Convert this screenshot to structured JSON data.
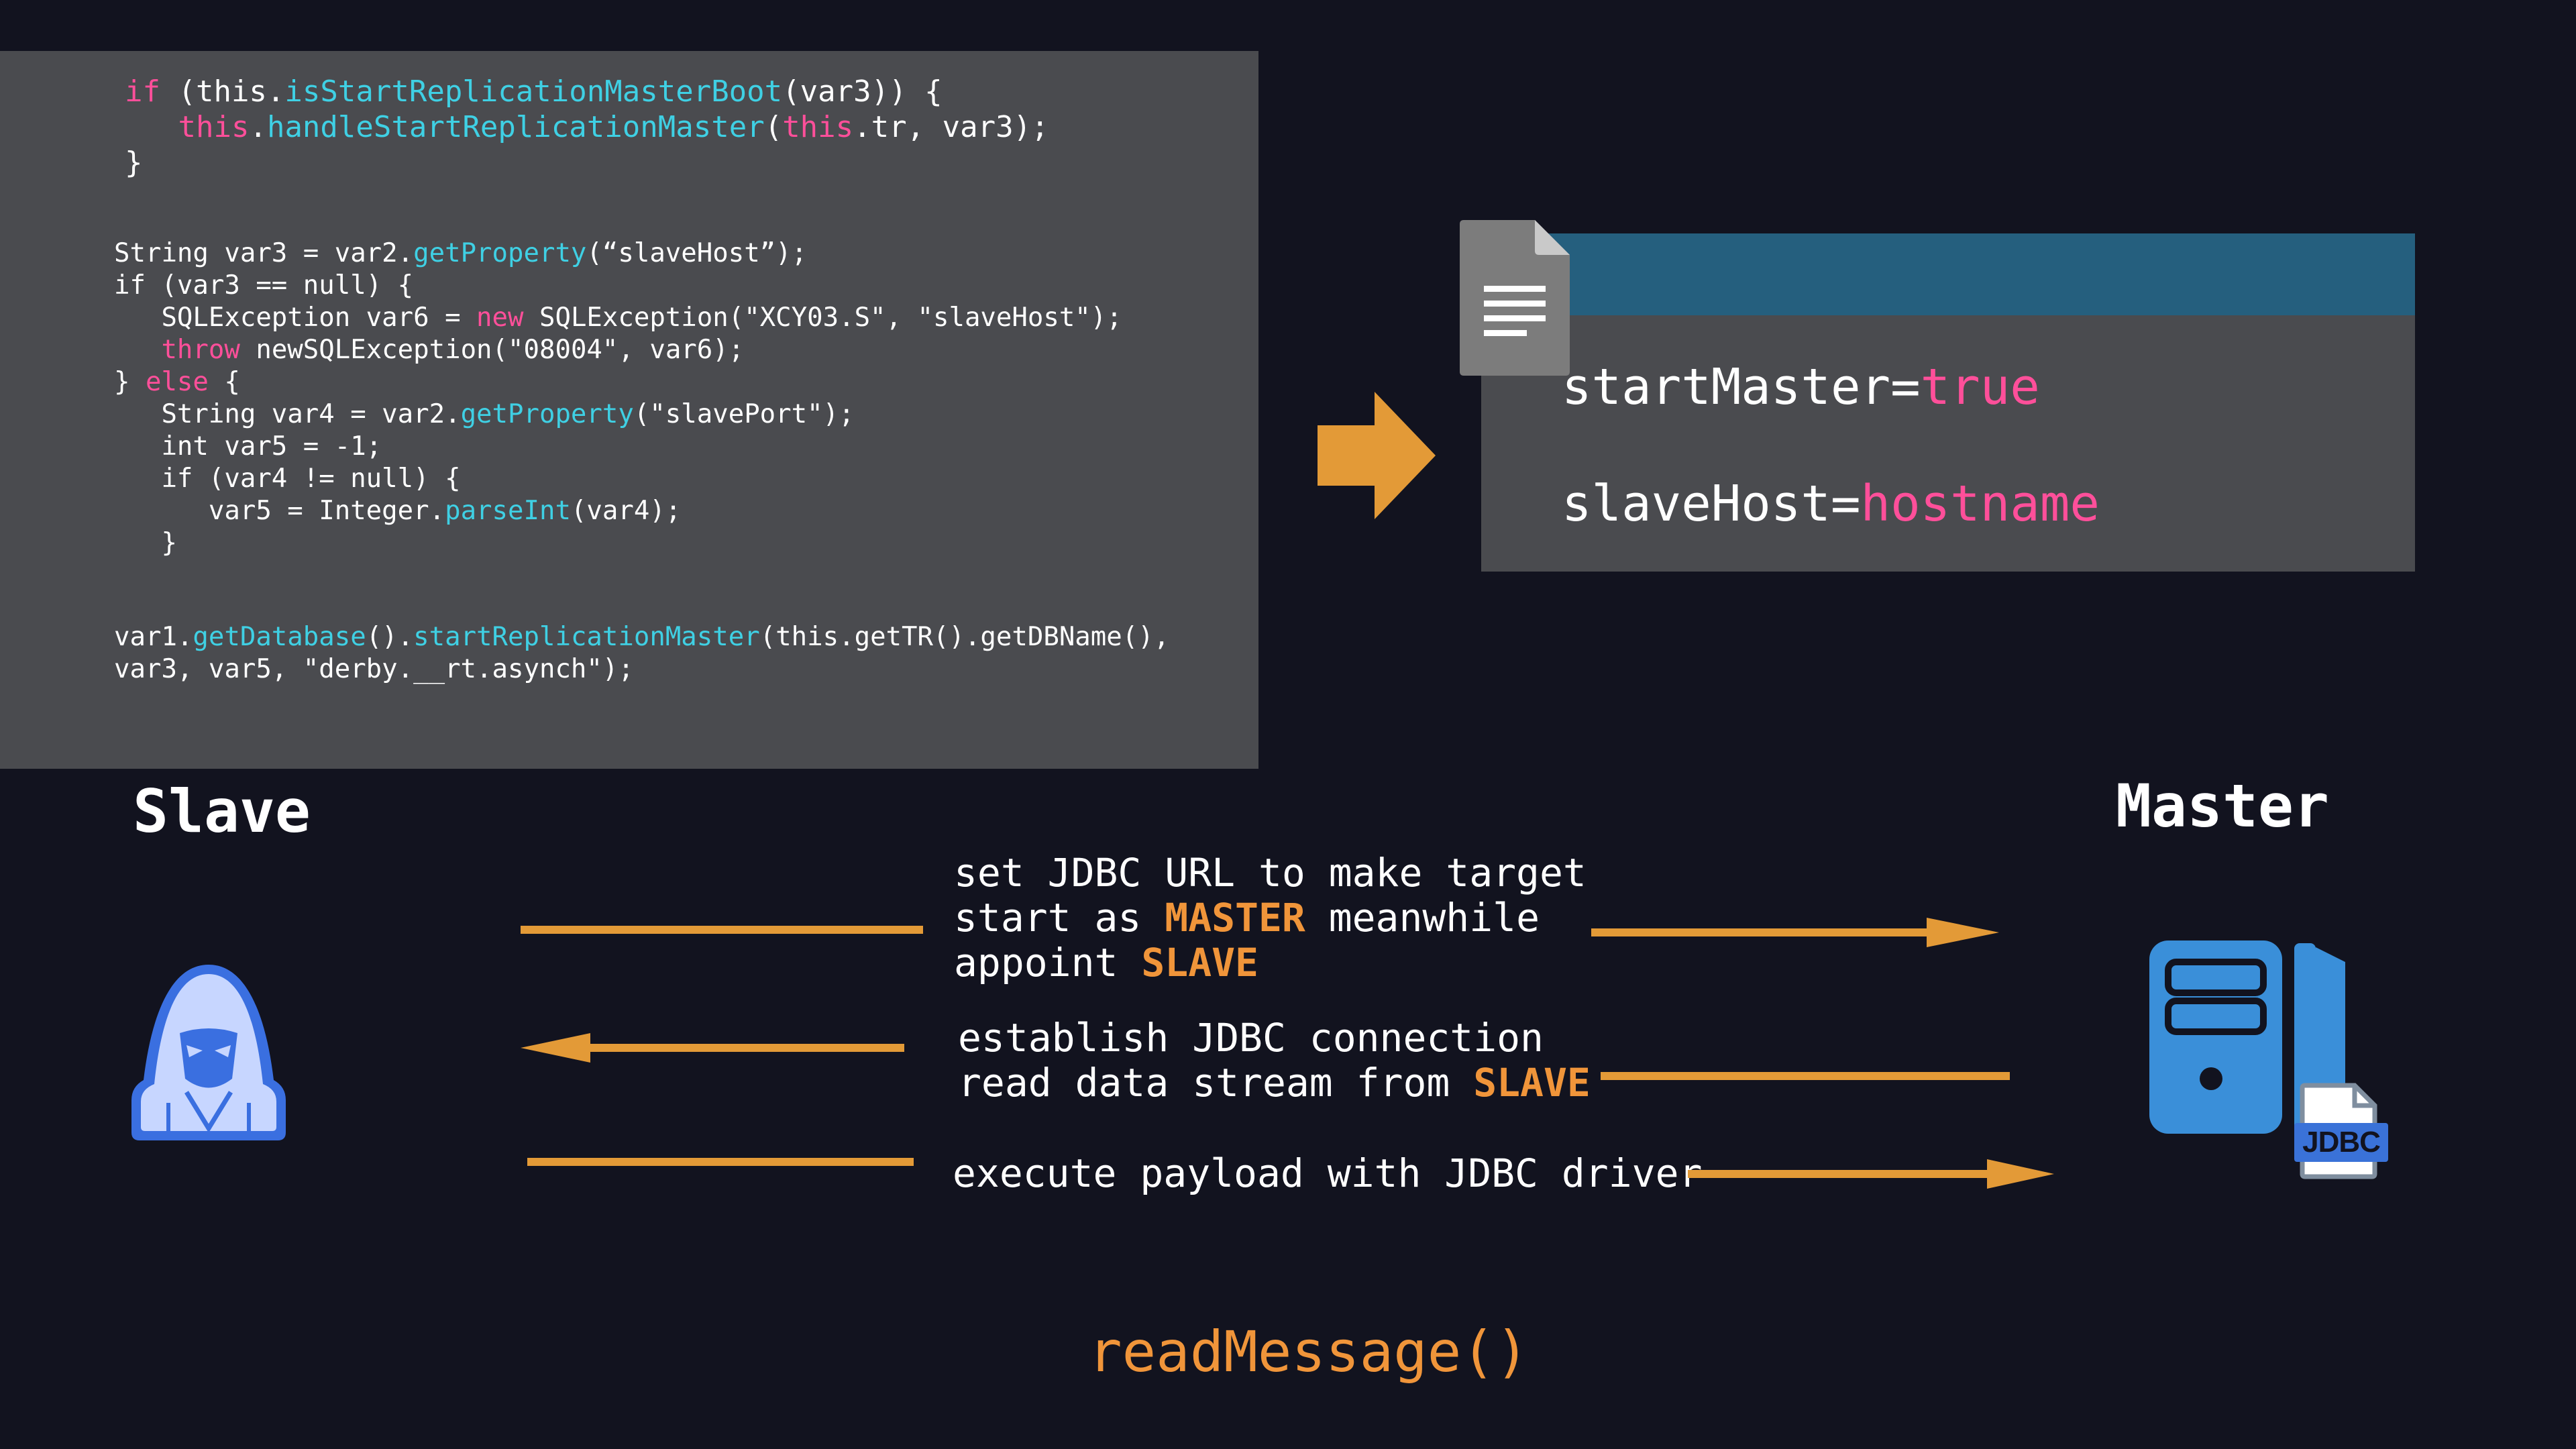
{
  "code": {
    "block1": [
      [
        {
          "t": "if",
          "c": "kw"
        },
        {
          "t": " (this."
        },
        {
          "t": "isStartReplicationMasterBoot",
          "c": "fn"
        },
        {
          "t": "(var3)) {"
        }
      ],
      [
        {
          "t": "   "
        },
        {
          "t": "this",
          "c": "kw"
        },
        {
          "t": "."
        },
        {
          "t": "handleStartReplicationMaster",
          "c": "fn"
        },
        {
          "t": "("
        },
        {
          "t": "this",
          "c": "kw"
        },
        {
          "t": ".tr, var3);"
        }
      ],
      [
        {
          "t": "}"
        }
      ]
    ],
    "block2": [
      [
        {
          "t": "String var3 = var2."
        },
        {
          "t": "getProperty",
          "c": "fn"
        },
        {
          "t": "(“slaveHost”);"
        }
      ],
      [
        {
          "t": "if (var3 == null) {"
        }
      ],
      [
        {
          "t": "   SQLException var6 = "
        },
        {
          "t": "new",
          "c": "kw"
        },
        {
          "t": " SQLException(\"XCY03.S\", \"slaveHost\");"
        }
      ],
      [
        {
          "t": "   "
        },
        {
          "t": "throw",
          "c": "kw"
        },
        {
          "t": " newSQLException(\"08004\", var6);"
        }
      ],
      [
        {
          "t": "} "
        },
        {
          "t": "else",
          "c": "kw"
        },
        {
          "t": " {"
        }
      ],
      [
        {
          "t": "   String var4 = var2."
        },
        {
          "t": "getProperty",
          "c": "fn"
        },
        {
          "t": "(\"slavePort\");"
        }
      ],
      [
        {
          "t": "   int var5 = -1;"
        }
      ],
      [
        {
          "t": "   if (var4 != null) {"
        }
      ],
      [
        {
          "t": "      var5 = Integer."
        },
        {
          "t": "parseInt",
          "c": "fn"
        },
        {
          "t": "(var4);"
        }
      ],
      [
        {
          "t": "   }"
        }
      ]
    ],
    "block3": [
      [
        {
          "t": "var1."
        },
        {
          "t": "getDatabase",
          "c": "fn"
        },
        {
          "t": "()."
        },
        {
          "t": "startReplicationMaster",
          "c": "fn"
        },
        {
          "t": "(this.getTR().getDBName(),"
        }
      ],
      [
        {
          "t": "var3, var5, \"derby.__rt.asynch\");"
        }
      ]
    ]
  },
  "config": {
    "line1_key": "startMaster=",
    "line1_value": "true",
    "line2_key": "slaveHost=",
    "line2_value": "hostname"
  },
  "labels": {
    "slave_title": "Slave",
    "master_title": "Master",
    "jdbc_badge": "JDBC",
    "read_message": "readMessage()"
  },
  "messages": [
    [
      {
        "t": "set JDBC URL to make target\nstart as "
      },
      {
        "t": "MASTER",
        "c": "hl"
      },
      {
        "t": " meanwhile\nappoint "
      },
      {
        "t": "SLAVE",
        "c": "hl"
      }
    ],
    [
      {
        "t": "establish JDBC connection\nread data stream from "
      },
      {
        "t": "SLAVE",
        "c": "hl"
      }
    ],
    [
      {
        "t": "execute payload with JDBC driver"
      }
    ]
  ],
  "colors": {
    "background": "#12131f",
    "panel": "#4a4b4f",
    "header_bar": "#255f7e",
    "keyword": "#ff4f9a",
    "function": "#3fd0e4",
    "accent_orange": "#f0953a",
    "server_blue": "#3a8fd9"
  },
  "icons": [
    "document-icon",
    "right-arrow-icon",
    "hacker-icon",
    "server-icon",
    "jdbc-file-icon"
  ]
}
